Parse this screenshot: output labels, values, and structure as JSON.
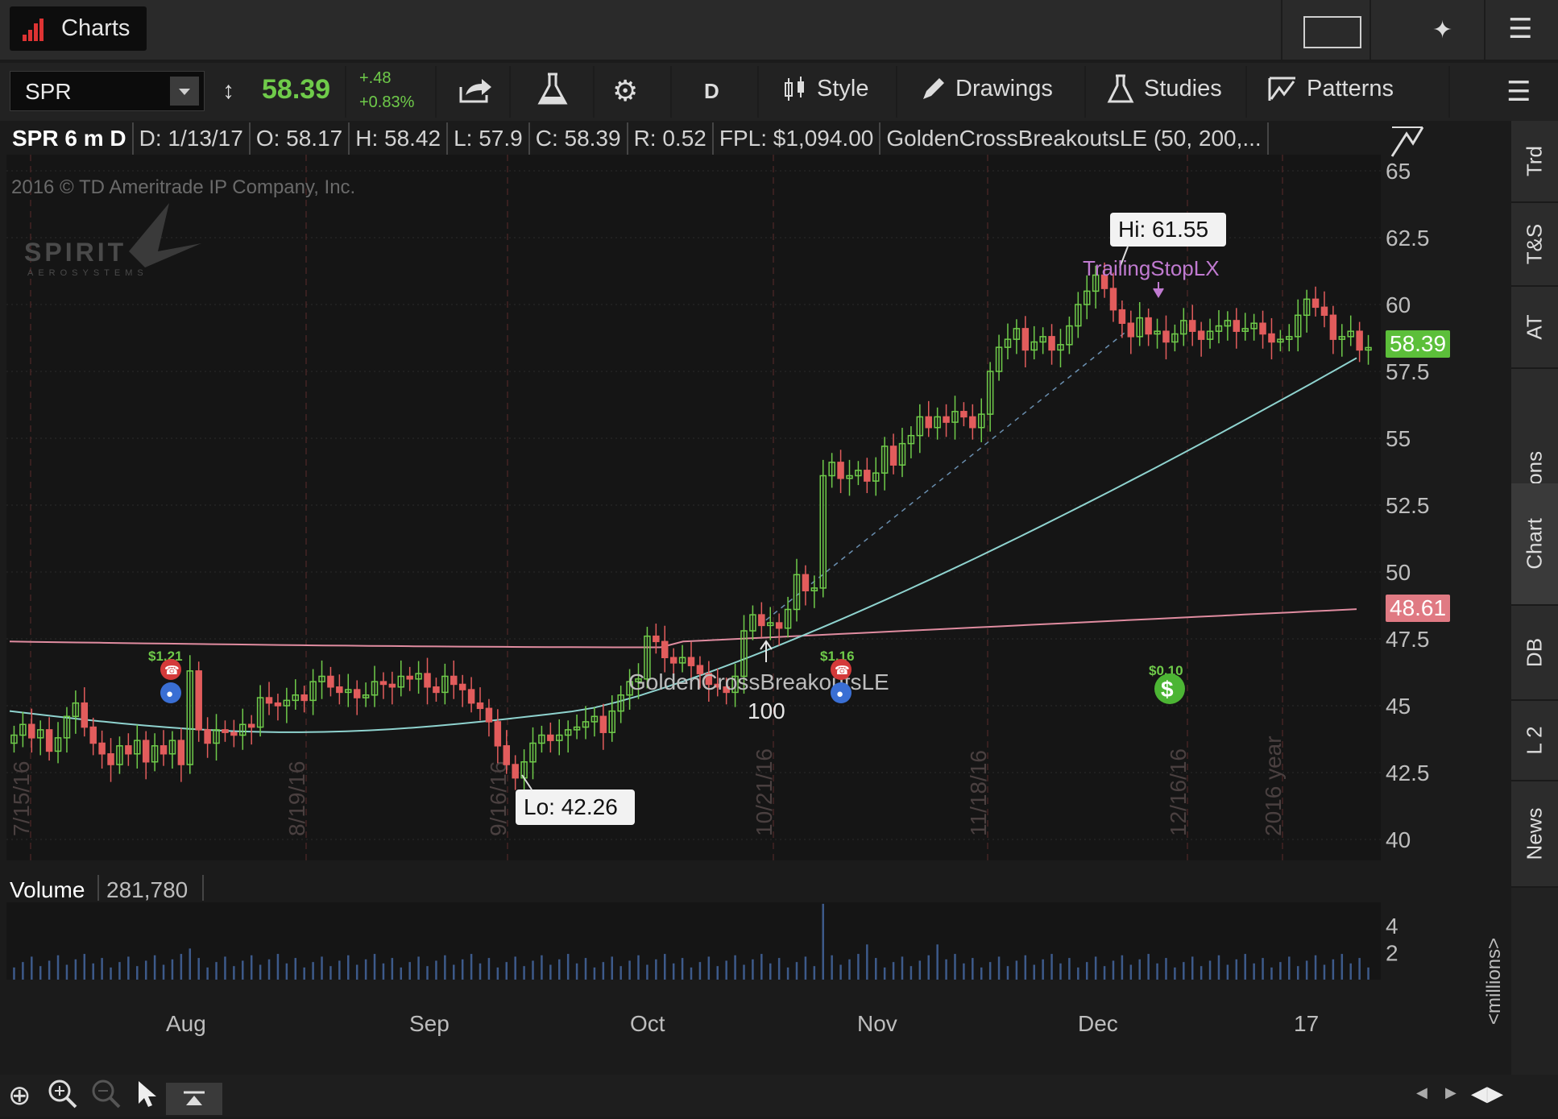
{
  "window": {
    "tab_label": "Charts"
  },
  "toolbar": {
    "symbol": "SPR",
    "last_price": "58.39",
    "change": "+.48",
    "change_pct": "+0.83%",
    "aggregation": "D",
    "style_label": "Style",
    "drawings_label": "Drawings",
    "studies_label": "Studies",
    "patterns_label": "Patterns"
  },
  "infobar": {
    "title": "SPR 6 m D",
    "date": "D: 1/13/17",
    "open": "O: 58.17",
    "high": "H: 58.42",
    "low": "L: 57.9",
    "close": "C: 58.39",
    "range": "R: 0.52",
    "fpl": "FPL: $1,094.00",
    "strategy": "GoldenCrossBreakoutsLE (50, 200,..."
  },
  "chart": {
    "copyright": "2016 © TD Ameritrade IP Company, Inc.",
    "logo_text": "SPIRIT",
    "logo_subtext": "AEROSYSTEMS",
    "hi_label": "Hi: 61.55",
    "lo_label": "Lo: 42.26",
    "trailing_stop_label": "TrailingStopLX",
    "golden_cross_label": "GoldenCrossBreakoutsLE",
    "golden_cross_qty": "100",
    "price_tag_last": "58.39",
    "price_tag_ma": "48.61",
    "vertical_date_labels": [
      "7/15/16",
      "8/19/16",
      "9/16/16",
      "10/21/16",
      "11/18/16",
      "12/16/16",
      "2016 year"
    ],
    "events": [
      {
        "amount": "$1.21",
        "type": "earnings"
      },
      {
        "amount": "$1.16",
        "type": "earnings"
      },
      {
        "amount": "$0.10",
        "type": "dividend"
      }
    ]
  },
  "volume": {
    "label": "Volume",
    "value": "281,780",
    "units_label": "<millions>"
  },
  "sidebar": {
    "tabs": [
      "Trd",
      "T&S",
      "AT",
      "Buttons",
      "Chart",
      "DB",
      "L 2",
      "News"
    ]
  },
  "colors": {
    "up": "#6fcb4a",
    "down": "#e25c5c",
    "ma_fast": "#8fd3cf",
    "ma_slow": "#e08ca0",
    "price_tag_green": "#5cbf3a",
    "price_tag_red": "#e07a83",
    "strategy_text": "#c07ad0"
  },
  "chart_data": {
    "type": "candlestick",
    "title": "SPR 6 m D",
    "y_ticks": [
      "65",
      "62.5",
      "60",
      "57.5",
      "55",
      "52.5",
      "50",
      "47.5",
      "45",
      "42.5",
      "40"
    ],
    "ylim": [
      40,
      65
    ],
    "x_ticks": [
      "Aug",
      "Sep",
      "Oct",
      "Nov",
      "Dec",
      "17"
    ],
    "volume_ticks": [
      "4",
      "2"
    ],
    "closes": [
      43.9,
      44.3,
      43.8,
      44.1,
      43.3,
      43.8,
      44.6,
      45.1,
      44.2,
      43.6,
      43.2,
      42.8,
      43.5,
      43.2,
      43.7,
      42.9,
      43.5,
      43.2,
      43.7,
      42.8,
      46.3,
      44.1,
      43.6,
      44.1,
      44.0,
      43.9,
      44.3,
      44.2,
      45.3,
      45.1,
      45.0,
      45.2,
      45.4,
      45.2,
      45.9,
      46.1,
      45.7,
      45.5,
      45.6,
      45.3,
      45.4,
      45.9,
      45.8,
      45.7,
      46.1,
      46.0,
      46.2,
      45.7,
      45.5,
      46.1,
      45.8,
      45.6,
      45.1,
      44.9,
      44.4,
      43.5,
      42.8,
      42.3,
      42.9,
      43.6,
      43.9,
      43.7,
      43.9,
      44.1,
      44.2,
      44.4,
      44.6,
      44.0,
      44.8,
      45.4,
      45.9,
      46.0,
      47.6,
      47.4,
      46.8,
      46.6,
      46.8,
      46.5,
      46.2,
      45.8,
      45.7,
      45.5,
      46.1,
      47.8,
      48.4,
      48.0,
      48.1,
      47.9,
      48.6,
      49.9,
      49.3,
      49.4,
      53.6,
      54.1,
      53.5,
      53.6,
      53.8,
      53.4,
      53.7,
      54.7,
      54.0,
      54.8,
      55.1,
      55.8,
      55.4,
      55.8,
      55.6,
      56.0,
      55.8,
      55.4,
      55.9,
      57.5,
      58.4,
      58.7,
      59.1,
      58.3,
      58.6,
      58.8,
      58.3,
      58.5,
      59.2,
      60.0,
      60.5,
      61.1,
      60.6,
      59.8,
      59.3,
      58.8,
      59.5,
      58.9,
      59.0,
      58.6,
      58.9,
      59.4,
      59.0,
      58.7,
      59.0,
      59.2,
      59.4,
      59.0,
      59.1,
      59.3,
      58.9,
      58.6,
      58.7,
      58.8,
      59.6,
      60.2,
      59.9,
      59.6,
      58.7,
      58.8,
      59.0,
      58.3,
      58.39
    ],
    "moving_averages": [
      {
        "period": "fast",
        "start": 44.8,
        "end": 58.0
      },
      {
        "period": "slow",
        "start": 47.4,
        "end": 48.61
      }
    ]
  }
}
